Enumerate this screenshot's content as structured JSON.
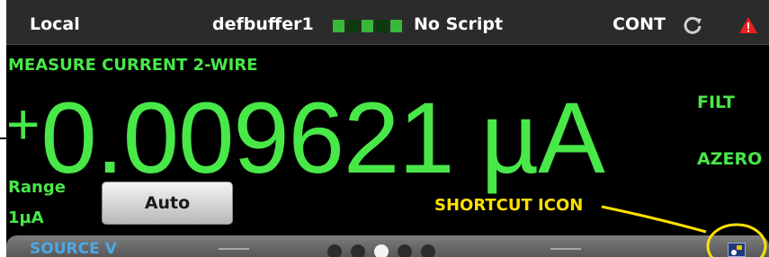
{
  "status_bar": {
    "local": "Local",
    "buffer": "defbuffer1",
    "script": "No Script",
    "trigger_mode": "CONT",
    "refresh_icon": "refresh-icon",
    "warning_icon": "warning-triangle-icon"
  },
  "measure": {
    "title": "MEASURE CURRENT 2-WIRE",
    "sign": "+",
    "value": "0.009621 µA",
    "filt": "FILT",
    "azero": "AZERO",
    "range_label": "Range",
    "range_value": "1µA",
    "range_button": "Auto"
  },
  "annotation": {
    "shortcut_label": "SHORTCUT ICON",
    "color": "#ffe000"
  },
  "swipe": {
    "title": "SOURCE V",
    "pages": 5,
    "active_page": 3
  },
  "colors": {
    "reading_green": "#48e848",
    "status_bg": "#2b2b2b",
    "warning_red": "#e82020"
  }
}
